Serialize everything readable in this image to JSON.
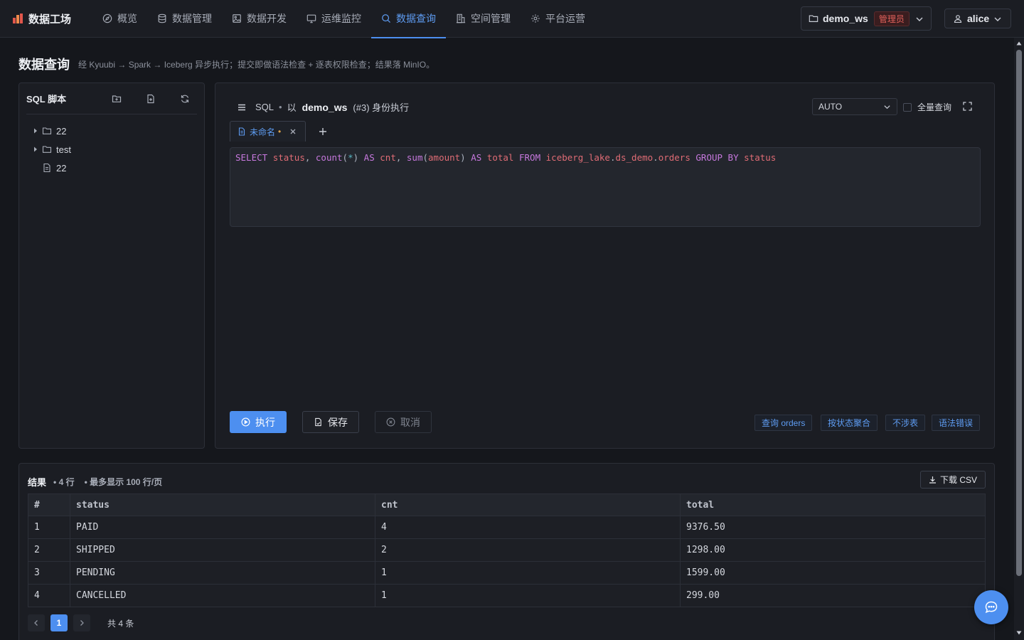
{
  "app": {
    "title": "数据工场"
  },
  "nav": [
    {
      "label": "概览",
      "icon": "compass-icon",
      "active": false
    },
    {
      "label": "数据管理",
      "icon": "database-icon",
      "active": false
    },
    {
      "label": "数据开发",
      "icon": "image-icon",
      "active": false
    },
    {
      "label": "运维监控",
      "icon": "monitor-icon",
      "active": false
    },
    {
      "label": "数据查询",
      "icon": "search-icon",
      "active": true
    },
    {
      "label": "空间管理",
      "icon": "building-icon",
      "active": false
    },
    {
      "label": "平台运营",
      "icon": "gear-icon",
      "active": false
    }
  ],
  "workspace": {
    "name": "demo_ws",
    "role": "管理员"
  },
  "user": {
    "name": "alice"
  },
  "page": {
    "title": "数据查询",
    "subtitle": "经 Kyuubi → Spark → Iceberg 异步执行；提交即做语法检查 + 逐表权限检查；结果落 MinIO。"
  },
  "scripts": {
    "title": "SQL 脚本",
    "items": [
      {
        "type": "folder",
        "name": "22"
      },
      {
        "type": "folder",
        "name": "test"
      },
      {
        "type": "file",
        "name": "22"
      }
    ]
  },
  "editor": {
    "lang": "SQL",
    "run_as_prefix": "以",
    "run_as_ws": "demo_ws",
    "run_as_suffix": "(#3) 身份执行",
    "mode": "AUTO",
    "full_query_label": "全量查询",
    "tab_name": "未命名",
    "tab_dirty_marker": "•",
    "sql_tokens": {
      "t1": "SELECT",
      "t2": "status",
      "t3": ",",
      "t4": "count",
      "t5": "(",
      "t6": "*",
      "t7": ")",
      "t8": "AS",
      "t9": "cnt",
      "t10": ",",
      "t11": "sum",
      "t12": "(",
      "t13": "amount",
      "t14": ")",
      "t15": "AS",
      "t16": "total",
      "t17": "FROM",
      "t18": "iceberg_lake",
      "t19": ".",
      "t20": "ds_demo",
      "t21": ".",
      "t22": "orders",
      "t23": "GROUP BY",
      "t24": "status"
    },
    "run_label": "执行",
    "save_label": "保存",
    "cancel_label": "取消",
    "quick_actions": [
      "查询 orders",
      "按状态聚合",
      "不涉表",
      "语法错误"
    ]
  },
  "results": {
    "title": "结果",
    "row_count": "4 行",
    "page_limit": "最多显示 100 行/页",
    "download_label": "下载 CSV",
    "columns": [
      "#",
      "status",
      "cnt",
      "total"
    ],
    "rows": [
      [
        "1",
        "PAID",
        "4",
        "9376.50"
      ],
      [
        "2",
        "SHIPPED",
        "2",
        "1298.00"
      ],
      [
        "3",
        "PENDING",
        "1",
        "1599.00"
      ],
      [
        "4",
        "CANCELLED",
        "1",
        "299.00"
      ]
    ],
    "page": "1",
    "total_text": "共 4 条"
  },
  "colors": {
    "accent": "#4d8ff0",
    "danger": "#e0605a",
    "background": "#15171c"
  }
}
